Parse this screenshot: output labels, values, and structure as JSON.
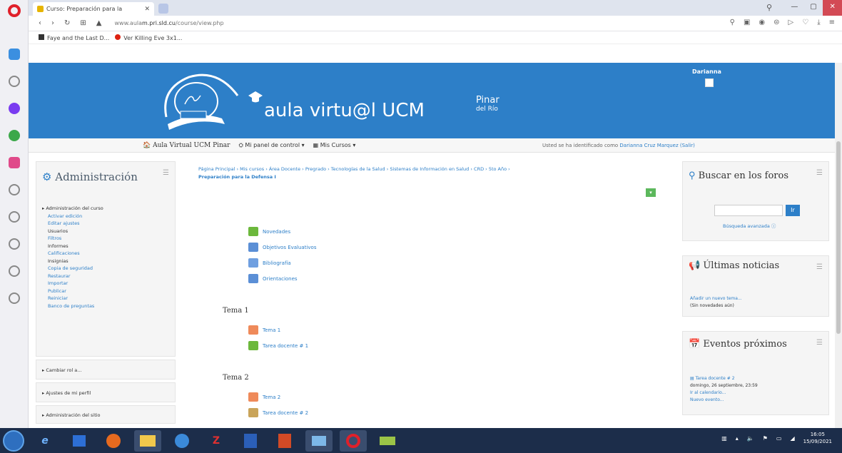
{
  "browser": {
    "tab_title": "Curso: Preparación para la",
    "url_prefix": "www.aula",
    "url_domain": "m.pri.sld.cu",
    "url_path": "/course/view.php",
    "bookmarks": [
      "Faye and the Last D...",
      "Ver Killing Eve 3x1..."
    ]
  },
  "header": {
    "logo_text_main": "aula virtu@l UCM",
    "logo_pinar": "Pinar",
    "logo_del_rio": "del Río",
    "user_name": "Darianna"
  },
  "site_nav": {
    "home": "Aula Virtual UCM Pinar",
    "dashboard": "Mi panel de control",
    "my_courses": "Mis Cursos",
    "login_text": "Usted se ha identificado como",
    "login_user": "Darianna Cruz Marquez (Salir)"
  },
  "admin": {
    "title": "Administración",
    "course_admin": "Administración del curso",
    "items": [
      "Activar edición",
      "Editar ajustes",
      "Usuarios",
      "Filtros",
      "Informes",
      "Calificaciones",
      "Insignias",
      "Copia de seguridad",
      "Restaurar",
      "Importar",
      "Publicar",
      "Reiniciar",
      "Banco de preguntas"
    ],
    "change_role": "Cambiar rol a...",
    "profile_settings": "Ajustes de mi perfil",
    "site_admin": "Administración del sitio"
  },
  "breadcrumb": {
    "path": "Página Principal › Mis cursos › Área Docente › Pregrado › Tecnologías de la Salud › Sistemas de Información en Salud › CRD › 5to Año ›",
    "current": "Preparación para la Defensa I"
  },
  "resources_top": [
    "Novedades",
    "Objetivos Evaluativos",
    "Bibliografía",
    "Orientaciones"
  ],
  "sections": [
    {
      "title": "Tema 1",
      "items": [
        "Tema 1",
        "Tarea docente # 1"
      ]
    },
    {
      "title": "Tema 2",
      "items": [
        "Tema 2",
        "Tarea docente # 2"
      ]
    }
  ],
  "search": {
    "title": "Buscar en los foros",
    "go": "Ir",
    "advanced": "Búsqueda avanzada"
  },
  "news": {
    "title": "Últimas noticias",
    "add": "Añadir un nuevo tema...",
    "none": "(Sin novedades aún)"
  },
  "events": {
    "title": "Eventos próximos",
    "event_name": "Tarea docente # 2",
    "event_date": "domingo, 26 septiembre, 23:59",
    "go_calendar": "Ir al calendario...",
    "new_event": "Nuevo evento..."
  },
  "taskbar": {
    "time": "16:05",
    "date": "15/09/2021"
  }
}
